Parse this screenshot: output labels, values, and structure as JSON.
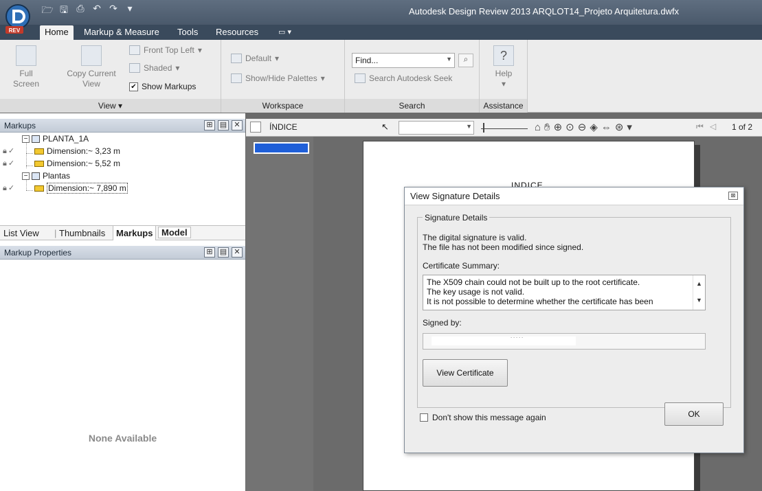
{
  "titlebar": {
    "title": "Autodesk Design Review 2013   ARQLOT14_Projeto Arquitetura.dwfx",
    "app_badge": "REV"
  },
  "ribbon_tabs": [
    "Home",
    "Markup & Measure",
    "Tools",
    "Resources"
  ],
  "ribbon": {
    "view_panel": {
      "full_screen": "Full Screen",
      "copy_current_view_1": "Copy Current",
      "copy_current_view_2": "View",
      "front_top_left": "Front Top Left",
      "shaded": "Shaded",
      "show_markups": "Show Markups",
      "label": "View"
    },
    "workspace_panel": {
      "default": "Default",
      "show_hide_palettes": "Show/Hide Palettes",
      "label": "Workspace"
    },
    "search_panel": {
      "find_placeholder": "Find...",
      "search_seek": "Search Autodesk Seek",
      "label": "Search"
    },
    "assistance_panel": {
      "help": "Help",
      "label": "Assistance"
    }
  },
  "markups_panel": {
    "title": "Markups",
    "tree": [
      {
        "label": "PLANTA_1A"
      },
      {
        "label": "Dimension:~ 3,23 m"
      },
      {
        "label": "Dimension:~ 5,52 m"
      },
      {
        "label": "Plantas"
      },
      {
        "label": "Dimension:~ 7,890 m"
      }
    ],
    "tabs": [
      "List View",
      "Thumbnails",
      "Markups",
      "Model"
    ],
    "properties_title": "Markup Properties",
    "properties_empty": "None Available"
  },
  "document": {
    "sheet_name": "ÍNDICE",
    "page_indicator": "1 of 2",
    "page_heading": "INDICE"
  },
  "dialog": {
    "title": "View Signature Details",
    "group_label": "Signature Details",
    "valid_line1": "The digital signature is valid.",
    "valid_line2": "The file has not been modified since signed.",
    "cert_summary_label": "Certificate Summary:",
    "cert_lines": [
      "The X509 chain could not be built up to the root certificate.",
      "The key usage is not valid.",
      "It is not possible to determine whether the certificate has been"
    ],
    "signed_by_label": "Signed by:",
    "view_certificate": "View Certificate",
    "dont_show": "Don't show this message again",
    "ok": "OK"
  },
  "colors": {
    "titlebar": "#4a596b",
    "ribbon": "#ececec",
    "panel_header": "#c3ccd7",
    "selected_thumb": "#1f5fd8"
  }
}
